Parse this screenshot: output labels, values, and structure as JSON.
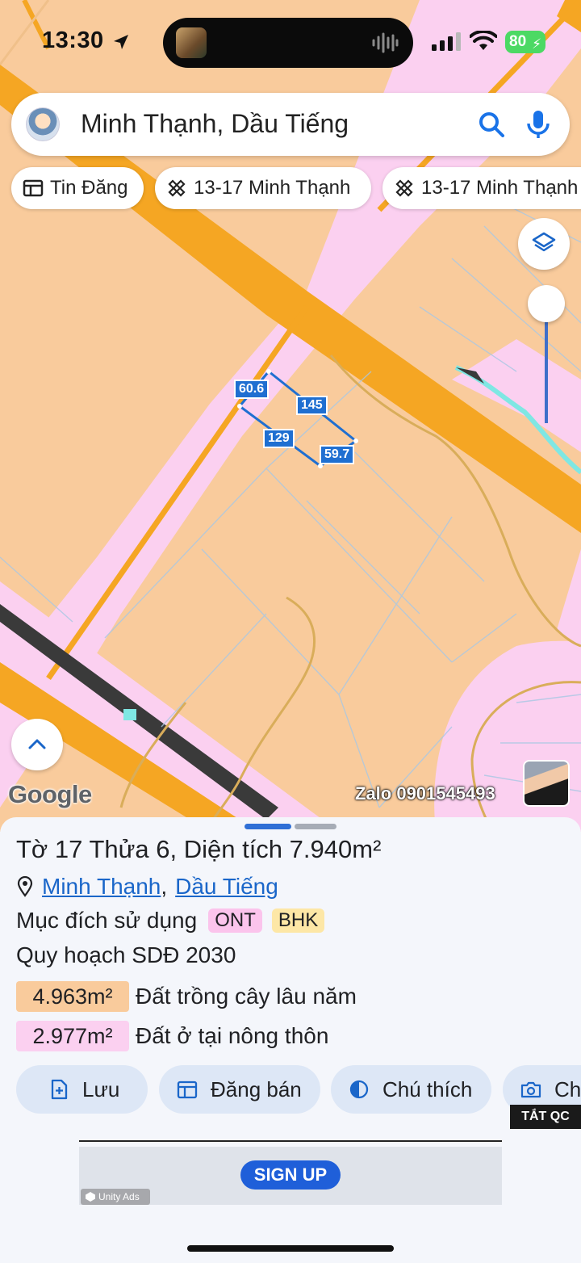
{
  "status_bar": {
    "time": "13:30",
    "battery": "80"
  },
  "search": {
    "query": "Minh Thạnh, Dầu Tiếng"
  },
  "chips": [
    {
      "label": "Tin Đăng",
      "icon": "listing-icon"
    },
    {
      "label": "13-17 Minh Thạnh",
      "icon": "parcel-icon"
    },
    {
      "label": "13-17 Minh Thạnh",
      "icon": "parcel-icon"
    }
  ],
  "map": {
    "google_label": "Google",
    "watermark": "Zalo 0901545493",
    "edge_labels": [
      "60.6",
      "145",
      "129",
      "59.7"
    ]
  },
  "parcel": {
    "title_prefix": "Tờ",
    "sheet_no": "17",
    "plot_label": "Thửa",
    "plot_no": "6",
    "area_label": ", Diện tích",
    "area_value": "7.940m²",
    "commune": "Minh Thạnh",
    "separator": ",",
    "district": "Dầu Tiếng",
    "purpose_label": "Mục đích sử dụng",
    "purpose_tags": [
      "ONT",
      "BHK"
    ],
    "plan_label": "Quy hoạch SDĐ 2030",
    "zones": [
      {
        "area": "4.963m²",
        "label": "Đất trồng cây lâu năm",
        "color": "#f9cb9c"
      },
      {
        "area": "2.977m²",
        "label": "Đất ở tại nông thôn",
        "color": "#fbd0f0"
      }
    ]
  },
  "actions": [
    {
      "label": "Lưu",
      "icon": "save-icon"
    },
    {
      "label": "Đăng bán",
      "icon": "post-sale-icon"
    },
    {
      "label": "Chú thích",
      "icon": "legend-icon"
    },
    {
      "label": "Ch",
      "icon": "camera-icon"
    }
  ],
  "hide_ads_label": "TẮT QC",
  "ad": {
    "button": "SIGN UP",
    "brand": "Unity Ads"
  },
  "colors": {
    "accent": "#1a66c9",
    "residential": "#fbd0f0",
    "perennial": "#f9cb9c",
    "road": "#f5a623"
  }
}
